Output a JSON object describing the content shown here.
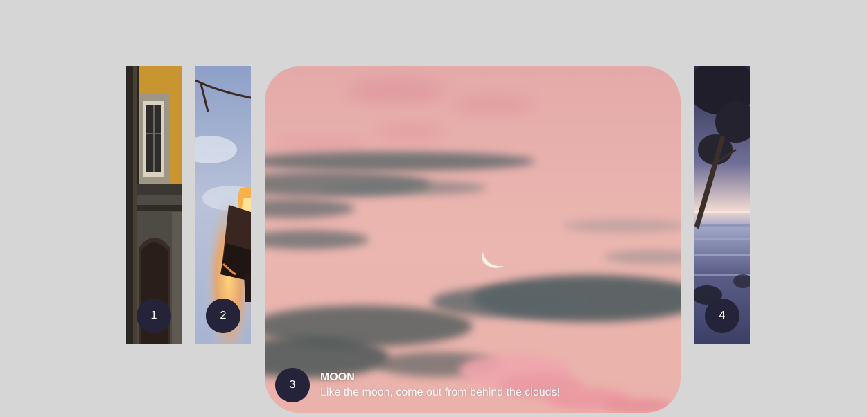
{
  "gallery": {
    "panels": [
      {
        "number": "1",
        "title": "",
        "description": "",
        "active": false
      },
      {
        "number": "2",
        "title": "",
        "description": "",
        "active": false
      },
      {
        "number": "3",
        "title": "Moon",
        "description": "Like the moon, come out from behind the clouds!",
        "active": true
      },
      {
        "number": "4",
        "title": "",
        "description": "",
        "active": false
      }
    ]
  },
  "colors": {
    "page_background": "#d6d6d6",
    "number_badge": "#25233a",
    "badge_text": "#ffffff",
    "sky_pink": "#e9b0ac"
  },
  "icons": {
    "panel_1_image": "building-facade-image",
    "panel_2_image": "campfire-image",
    "panel_3_image": "crescent-moon-sky-image",
    "panel_4_image": "seaside-tree-image"
  }
}
